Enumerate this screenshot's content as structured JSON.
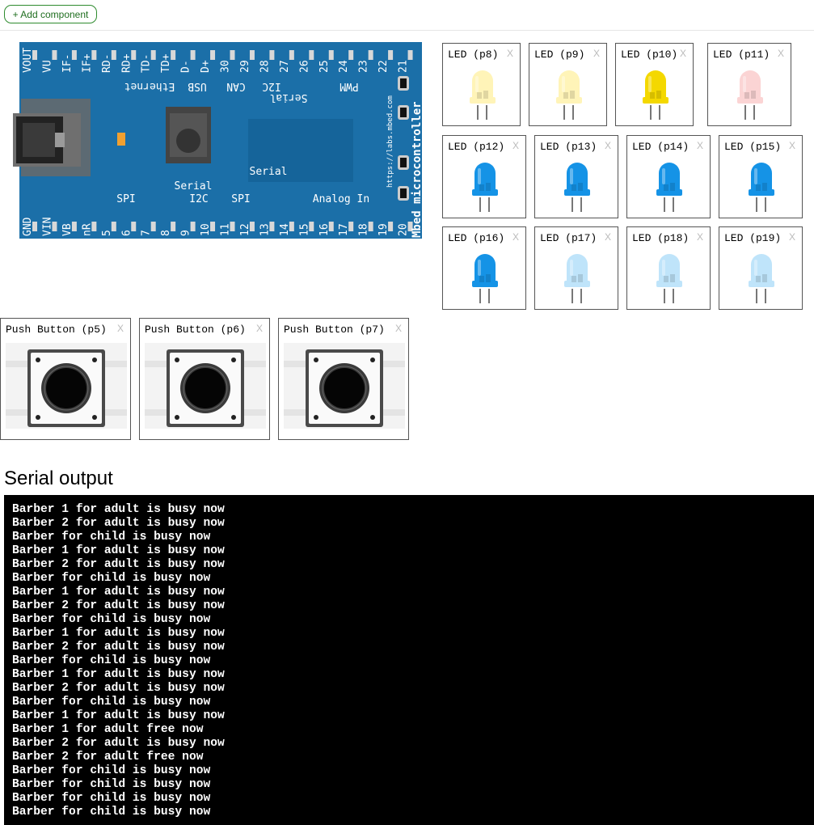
{
  "toolbar": {
    "add_component_label": "+ Add component"
  },
  "board": {
    "brand_label": "Mbed microcontroller",
    "url_label": "https://labs.mbed.com",
    "top_pins": [
      "VOUT",
      "VU",
      "IF-",
      "IF+",
      "RD-",
      "RD+",
      "TD-",
      "TD+",
      "D-",
      "D+",
      "30",
      "29",
      "28",
      "27",
      "26",
      "25",
      "24",
      "23",
      "22",
      "21"
    ],
    "bottom_pins": [
      "GND",
      "VIN",
      "VB",
      "nR",
      "5",
      "6",
      "7",
      "8",
      "9",
      "10",
      "11",
      "12",
      "13",
      "14",
      "15",
      "16",
      "17",
      "18",
      "19",
      "20"
    ],
    "top_groups": [
      "Ethernet",
      "USB",
      "CAN",
      "I2C",
      "Serial",
      "PWM"
    ],
    "bottom_groups": [
      "SPI",
      "Serial",
      "I2C",
      "SPI",
      "Serial",
      "Analog In"
    ],
    "colors": {
      "board": "#1b6fa8",
      "chip": "#15649a",
      "pad": "#d8d8d8",
      "led": "#f0a030"
    }
  },
  "leds": [
    {
      "label": "LED (p8)",
      "close": "X",
      "color": "#fff4b8",
      "state": "off"
    },
    {
      "label": "LED (p9)",
      "close": "X",
      "color": "#fff4b8",
      "state": "off"
    },
    {
      "label": "LED (p10)",
      "close": "X",
      "color": "#f4d800",
      "state": "on"
    },
    {
      "label": "LED (p11)",
      "close": "X",
      "color": "#fbd4d4",
      "state": "off"
    },
    {
      "label": "LED (p12)",
      "close": "X",
      "color": "#1593e6",
      "state": "on"
    },
    {
      "label": "LED (p13)",
      "close": "X",
      "color": "#1593e6",
      "state": "on"
    },
    {
      "label": "LED (p14)",
      "close": "X",
      "color": "#1593e6",
      "state": "on"
    },
    {
      "label": "LED (p15)",
      "close": "X",
      "color": "#1593e6",
      "state": "on"
    },
    {
      "label": "LED (p16)",
      "close": "X",
      "color": "#1593e6",
      "state": "on"
    },
    {
      "label": "LED (p17)",
      "close": "X",
      "color": "#bfe4fa",
      "state": "off"
    },
    {
      "label": "LED (p18)",
      "close": "X",
      "color": "#bfe4fa",
      "state": "off"
    },
    {
      "label": "LED (p19)",
      "close": "X",
      "color": "#bfe4fa",
      "state": "off"
    }
  ],
  "buttons": [
    {
      "label": "Push Button (p5)",
      "close": "X"
    },
    {
      "label": "Push Button (p6)",
      "close": "X"
    },
    {
      "label": "Push Button (p7)",
      "close": "X"
    }
  ],
  "serial": {
    "title": "Serial output",
    "lines": [
      "Barber 1 for adult is busy now",
      "Barber 2 for adult is busy now",
      "Barber for child is busy now",
      "Barber 1 for adult is busy now",
      "Barber 2 for adult is busy now",
      "Barber for child is busy now",
      "Barber 1 for adult is busy now",
      "Barber 2 for adult is busy now",
      "Barber for child is busy now",
      "Barber 1 for adult is busy now",
      "Barber 2 for adult is busy now",
      "Barber for child is busy now",
      "Barber 1 for adult is busy now",
      "Barber 2 for adult is busy now",
      "Barber for child is busy now",
      "Barber 1 for adult is busy now",
      "Barber 1 for adult free now",
      "Barber 2 for adult is busy now",
      "Barber 2 for adult free now",
      "Barber for child is busy now",
      "Barber for child is busy now",
      "Barber for child is busy now",
      "Barber for child is busy now"
    ]
  }
}
